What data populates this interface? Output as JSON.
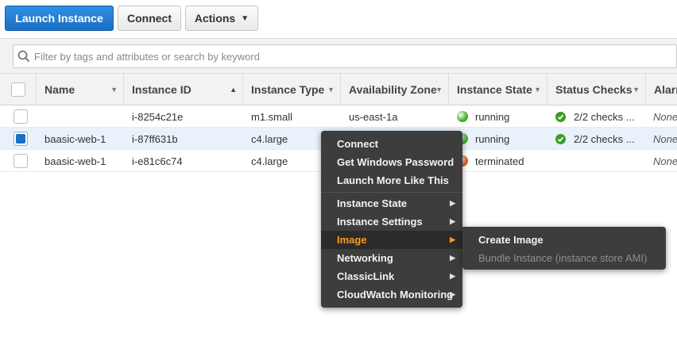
{
  "toolbar": {
    "launch_label": "Launch Instance",
    "connect_label": "Connect",
    "actions_label": "Actions"
  },
  "search": {
    "placeholder": "Filter by tags and attributes or search by keyword"
  },
  "table": {
    "columns": [
      "Name",
      "Instance ID",
      "Instance Type",
      "Availability Zone",
      "Instance State",
      "Status Checks",
      "Alarm"
    ],
    "rows": [
      {
        "name": "",
        "id": "i-8254c21e",
        "type": "m1.small",
        "zone": "us-east-1a",
        "state": "running",
        "state_color": "#3fae2a",
        "checks": "2/2 checks ...",
        "alarm": "None",
        "selected": false
      },
      {
        "name": "baasic-web-1",
        "id": "i-87ff631b",
        "type": "c4.large",
        "zone": "",
        "state": "running",
        "state_color": "#3fae2a",
        "checks": "2/2 checks ...",
        "alarm": "None",
        "selected": true
      },
      {
        "name": "baasic-web-1",
        "id": "i-e81c6c74",
        "type": "c4.large",
        "zone": "",
        "state": "terminated",
        "state_color": "#e05a2b",
        "checks": "",
        "alarm": "None",
        "selected": false
      }
    ]
  },
  "context_menu": {
    "group1": [
      "Connect",
      "Get Windows Password",
      "Launch More Like This"
    ],
    "group2": [
      "Instance State",
      "Instance Settings",
      "Image",
      "Networking",
      "ClassicLink",
      "CloudWatch Monitoring"
    ],
    "active": "Image"
  },
  "submenu": {
    "items": [
      "Create Image",
      "Bundle Instance (instance store AMI)"
    ]
  },
  "colors": {
    "primary": "#1a6fc4",
    "menu_bg": "#3d3d3d",
    "menu_active_text": "#f89c1c",
    "running": "#3fae2a",
    "terminated": "#e05a2b"
  }
}
